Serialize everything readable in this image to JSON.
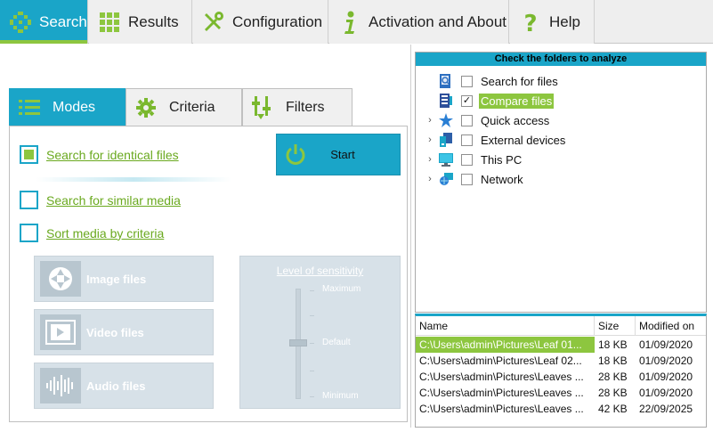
{
  "top_tabs": [
    {
      "label": "Search",
      "icon": "search-grid-icon",
      "active": true
    },
    {
      "label": "Results",
      "icon": "results-grid-icon"
    },
    {
      "label": "Configuration",
      "icon": "tools-icon"
    },
    {
      "label": "Activation and About",
      "icon": "info-icon"
    },
    {
      "label": "Help",
      "icon": "question-icon"
    }
  ],
  "sub_tabs": [
    {
      "label": "Modes",
      "icon": "list-icon",
      "active": true
    },
    {
      "label": "Criteria",
      "icon": "gear-icon"
    },
    {
      "label": "Filters",
      "icon": "filter-sliders-icon"
    }
  ],
  "modes": {
    "options": [
      {
        "label": "Search for identical files",
        "checked": true
      },
      {
        "label": "Search for similar media",
        "checked": false
      },
      {
        "label": "Sort media by criteria",
        "checked": false
      }
    ],
    "start_label": "Start",
    "media_buttons": [
      {
        "label": "Image files",
        "icon": "aperture-icon"
      },
      {
        "label": "Video files",
        "icon": "video-icon"
      },
      {
        "label": "Audio files",
        "icon": "waveform-icon"
      }
    ],
    "sensitivity": {
      "title": "Level of sensitivity",
      "max": "Maximum",
      "default": "Default",
      "min": "Minimum"
    }
  },
  "tree": {
    "header": "Check the folders to analyze",
    "items": [
      {
        "label": "Search for files",
        "icon": "search-files-icon",
        "expandable": false,
        "checked": false,
        "selected": false
      },
      {
        "label": "Compare files",
        "icon": "compare-files-icon",
        "expandable": false,
        "checked": true,
        "selected": true
      },
      {
        "label": "Quick access",
        "icon": "star-icon",
        "expandable": true,
        "checked": false,
        "selected": false
      },
      {
        "label": "External devices",
        "icon": "external-devices-icon",
        "expandable": true,
        "checked": false,
        "selected": false
      },
      {
        "label": "This PC",
        "icon": "monitor-icon",
        "expandable": true,
        "checked": false,
        "selected": false
      },
      {
        "label": "Network",
        "icon": "network-icon",
        "expandable": true,
        "checked": false,
        "selected": false
      }
    ]
  },
  "files": {
    "columns": [
      "Name",
      "Size",
      "Modified on"
    ],
    "rows": [
      {
        "name": "C:\\Users\\admin\\Pictures\\Leaf 01...",
        "size": "18 KB",
        "modified": "01/09/2020",
        "selected": true
      },
      {
        "name": "C:\\Users\\admin\\Pictures\\Leaf 02...",
        "size": "18 KB",
        "modified": "01/09/2020",
        "selected": false
      },
      {
        "name": "C:\\Users\\admin\\Pictures\\Leaves ...",
        "size": "28 KB",
        "modified": "01/09/2020",
        "selected": false
      },
      {
        "name": "C:\\Users\\admin\\Pictures\\Leaves ...",
        "size": "28 KB",
        "modified": "01/09/2020",
        "selected": false
      },
      {
        "name": "C:\\Users\\admin\\Pictures\\Leaves ...",
        "size": "42 KB",
        "modified": "22/09/2025",
        "selected": false
      }
    ]
  },
  "colors": {
    "accent": "#1aa5c8",
    "highlight": "#8dc63f",
    "disabled": "#d7e1e8"
  }
}
